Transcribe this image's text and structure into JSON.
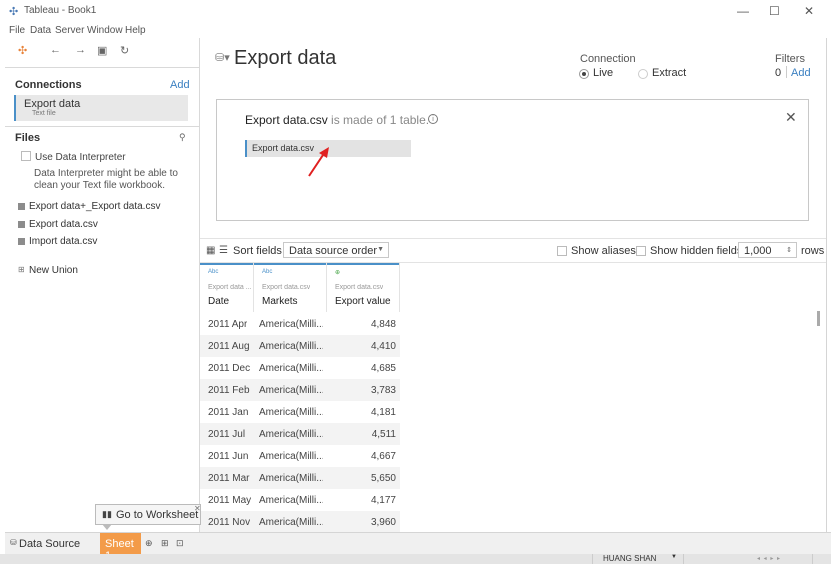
{
  "window": {
    "title": "Tableau - Book1",
    "app_icon": "tableau-logo-icon",
    "min": "—",
    "max": "☐",
    "close": "✕"
  },
  "menu": [
    "File",
    "Data",
    "Server",
    "Window",
    "Help"
  ],
  "left": {
    "connections_heading": "Connections",
    "add_label": "Add",
    "connection": {
      "name": "Export data",
      "type": "Text file"
    },
    "files_heading": "Files",
    "use_interpreter": "Use Data Interpreter",
    "interpreter_hint": [
      "Data Interpreter might be able to",
      "clean your Text file workbook."
    ],
    "files": [
      "Export data+_Export data.csv",
      "Export data.csv",
      "Import data.csv"
    ],
    "new_union": "New Union"
  },
  "header": {
    "title": "Export data",
    "connection_label": "Connection",
    "live": "Live",
    "extract": "Extract",
    "filters_label": "Filters",
    "filters_count": "0",
    "filters_add": "Add"
  },
  "canvas": {
    "title_name": "Export data.csv",
    "title_rest": " is made of 1 table.",
    "table_chip": "Export data.csv"
  },
  "grid_toolbar": {
    "sort_label": "Sort fields",
    "sort_value": "Data source order",
    "show_aliases": "Show aliases",
    "show_hidden": "Show hidden fields",
    "rows_value": "1,000",
    "rows_label": "rows"
  },
  "grid": {
    "columns": [
      {
        "type": "Abc",
        "source": "Export data ...",
        "field": "Date"
      },
      {
        "type": "Abc",
        "source": "Export data.csv",
        "field": "Markets"
      },
      {
        "type": "⊕",
        "source": "Export data.csv",
        "field": "Export value"
      }
    ],
    "rows": [
      [
        "2011 Apr",
        "America(Milli...",
        "4,848"
      ],
      [
        "2011 Aug",
        "America(Milli...",
        "4,410"
      ],
      [
        "2011 Dec",
        "America(Milli...",
        "4,685"
      ],
      [
        "2011 Feb",
        "America(Milli...",
        "3,783"
      ],
      [
        "2011 Jan",
        "America(Milli...",
        "4,181"
      ],
      [
        "2011 Jul",
        "America(Milli...",
        "4,511"
      ],
      [
        "2011 Jun",
        "America(Milli...",
        "4,667"
      ],
      [
        "2011 Mar",
        "America(Milli...",
        "5,650"
      ],
      [
        "2011 May",
        "America(Milli...",
        "4,177"
      ],
      [
        "2011 Nov",
        "America(Milli...",
        "3,960"
      ]
    ]
  },
  "tooltip": {
    "label": "Go to Worksheet"
  },
  "tabs": {
    "data_source": "Data Source",
    "sheet": "Sheet 1"
  },
  "status": {
    "user": "HUANG SHAN"
  }
}
